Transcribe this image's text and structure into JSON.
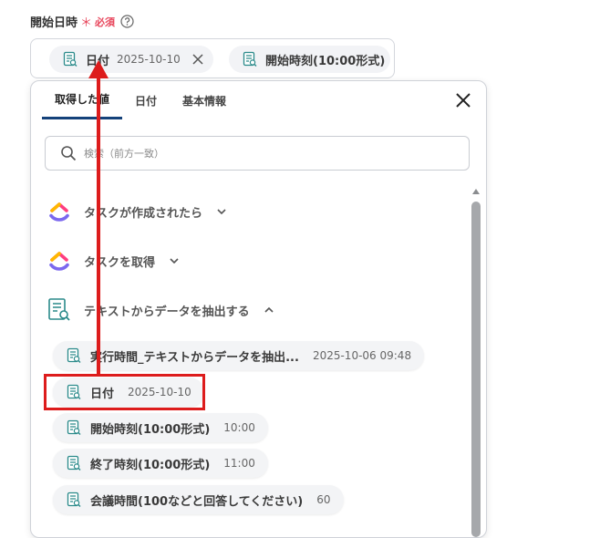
{
  "field": {
    "label": "開始日時",
    "required_mark": "＊",
    "required_text": "必須"
  },
  "input_chips": [
    {
      "name": "日付",
      "value": "2025-10-10"
    },
    {
      "name": "開始時刻(10:00形式)",
      "value": ""
    }
  ],
  "tabs": [
    "取得した値",
    "日付",
    "基本情報"
  ],
  "search": {
    "placeholder": "検索（前方一致）"
  },
  "groups": [
    {
      "label": "タスクが作成されたら",
      "expanded": false,
      "icon": "clickup-logo-icon"
    },
    {
      "label": "タスクを取得",
      "expanded": false,
      "icon": "clickup-logo-icon"
    },
    {
      "label": "テキストからデータを抽出する",
      "expanded": true,
      "icon": "ai-extract-icon"
    }
  ],
  "items": [
    {
      "name": "実行時間_テキストからデータを抽出...",
      "value": "2025-10-06 09:48"
    },
    {
      "name": "日付",
      "value": "2025-10-10"
    },
    {
      "name": "開始時刻(10:00形式)",
      "value": "10:00"
    },
    {
      "name": "終了時刻(10:00形式)",
      "value": "11:00"
    },
    {
      "name": "会議時間(100などと回答してください)",
      "value": "60"
    }
  ],
  "colors": {
    "required": "#e8455b",
    "tab_active": "#15427a",
    "highlight": "#dd1c1c",
    "doc_icon": "#2a8a8a"
  }
}
